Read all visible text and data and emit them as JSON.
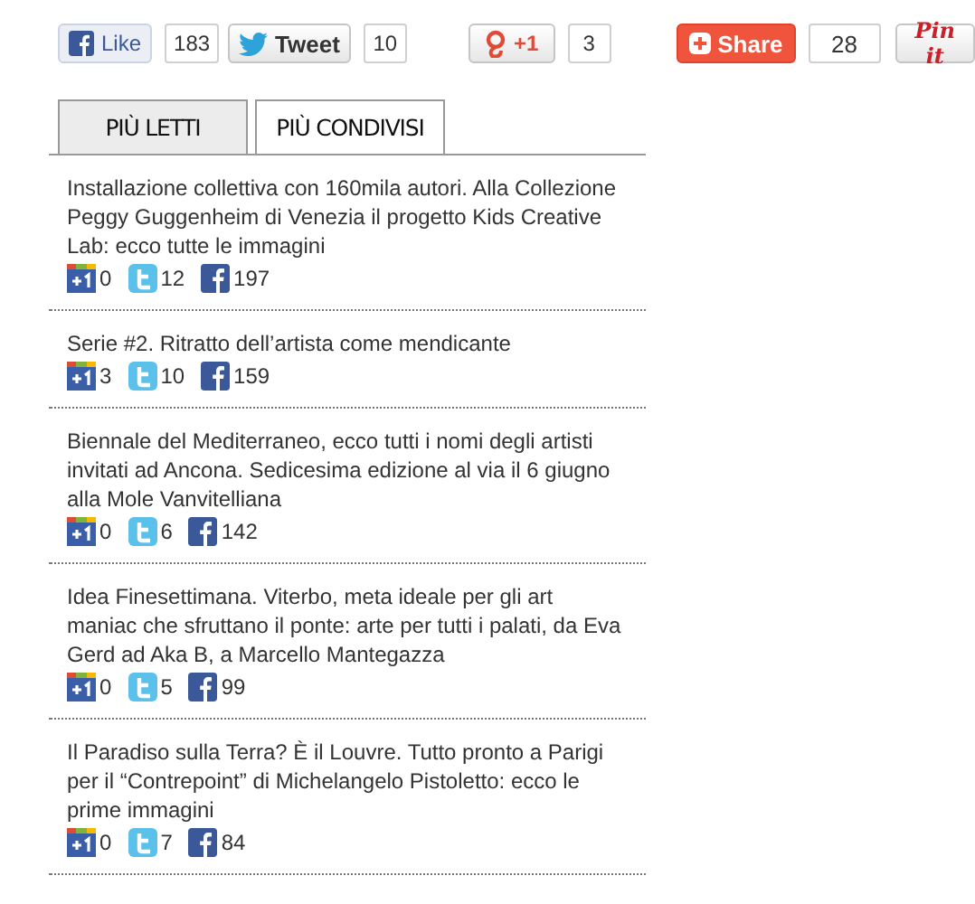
{
  "share_bar": [
    {
      "kind": "facebook",
      "label": "Like",
      "count": "183"
    },
    {
      "kind": "twitter",
      "label": "Tweet",
      "count": "10"
    },
    {
      "kind": "google",
      "label": "+1",
      "count": "3"
    },
    {
      "kind": "share",
      "label": "Share",
      "count": "28"
    },
    {
      "kind": "pinterest",
      "label": "Pin it"
    }
  ],
  "tabs": [
    {
      "label": "PIÙ LETTI",
      "selected": false
    },
    {
      "label": "PIÙ CONDIVISI",
      "selected": true
    }
  ],
  "articles": [
    {
      "title": "Installazione collettiva con 160mila autori. Alla Collezione Peggy Guggenheim di Venezia il progetto Kids Creative Lab: ecco tutte le immagini",
      "google": "0",
      "twitter": "12",
      "facebook": "197"
    },
    {
      "title": "Serie #2. Ritratto dell’artista come mendicante",
      "google": "3",
      "twitter": "10",
      "facebook": "159"
    },
    {
      "title": "Biennale del Mediterraneo, ecco tutti i nomi degli artisti invitati ad Ancona. Sedicesima edizione al via il 6 giugno alla Mole Vanvitelliana",
      "google": "0",
      "twitter": "6",
      "facebook": "142"
    },
    {
      "title": "Idea Finesettimana. Viterbo, meta ideale per gli art maniac che sfruttano il ponte: arte per tutti i palati, da Eva Gerd ad Aka B, a Marcello Mantegazza",
      "google": "0",
      "twitter": "5",
      "facebook": "99"
    },
    {
      "title": "Il Paradiso sulla Terra? È il Louvre. Tutto pronto a Parigi per il “Contrepoint” di Michelangelo Pistoletto: ecco le prime immagini",
      "google": "0",
      "twitter": "7",
      "facebook": "84"
    }
  ]
}
